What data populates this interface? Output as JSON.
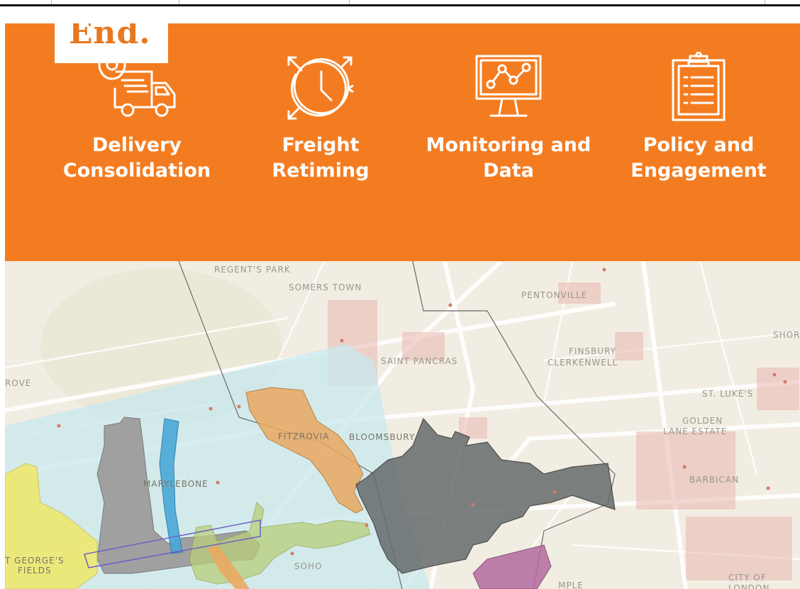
{
  "brand": {
    "logo_text": "End."
  },
  "features": [
    {
      "icon": "delivery-truck-icon",
      "label_line1": "Delivery",
      "label_line2": "Consolidation"
    },
    {
      "icon": "clock-retiming-icon",
      "label_line1": "Freight",
      "label_line2": "Retiming"
    },
    {
      "icon": "monitor-chart-icon",
      "label_line1": "Monitoring and",
      "label_line2": "Data"
    },
    {
      "icon": "clipboard-checklist-icon",
      "label_line1": "Policy and",
      "label_line2": "Engagement"
    }
  ],
  "colors": {
    "banner": "#f47c20",
    "logo_text": "#e8781e",
    "map_background": "#f2ede2",
    "zone_cyan": "#c8e8ee",
    "zone_orange": "#eaa860",
    "zone_dark_grey": "#666b6c",
    "zone_grey": "#999494",
    "zone_blue": "#4aa8d8",
    "zone_yellow": "#f0e868",
    "zone_green": "#b8cf7a",
    "zone_magenta": "#b46aa0"
  },
  "map": {
    "places": [
      "REGENT'S PARK",
      "SOMERS TOWN",
      "PENTONVILLE",
      "SHOR",
      "SAINT PANCRAS",
      "FINSBURY",
      "CLERKENWELL",
      "ROVE",
      "ST. LUKE'S",
      "GOLDEN",
      "LANE ESTATE",
      "FITZROVIA",
      "BLOOMSBURY",
      "MARYLEBONE",
      "BARBICAN",
      "T GEORGE'S",
      "FIELDS",
      "SOHO",
      "MPLE",
      "CITY OF",
      "LONDON"
    ]
  }
}
